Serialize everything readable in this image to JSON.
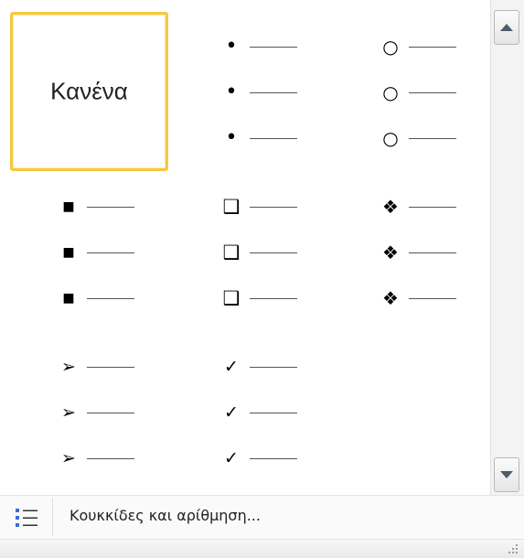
{
  "gallery": {
    "none_label": "Κανένα",
    "cells": [
      {
        "name": "bullet-dot",
        "glyph": "•",
        "style": "g-dot"
      },
      {
        "name": "bullet-hollow-circle",
        "glyph": "○",
        "style": "g-circle"
      },
      {
        "name": "bullet-filled-square",
        "glyph": "■",
        "style": "g-square"
      },
      {
        "name": "bullet-hollow-box",
        "glyph": "❑",
        "style": "g-box"
      },
      {
        "name": "bullet-four-diamond",
        "glyph": "❖",
        "style": "g-diamond"
      },
      {
        "name": "bullet-arrowhead",
        "glyph": "➢",
        "style": "g-arrow"
      },
      {
        "name": "bullet-checkmark",
        "glyph": "✓",
        "style": "g-check"
      }
    ]
  },
  "scrollbar": {
    "up_icon": "triangle-up-icon",
    "down_icon": "triangle-down-icon"
  },
  "menu": {
    "define_bullets_label": "Κουκκίδες και αρίθμηση...",
    "icon": "bulleted-list-icon"
  },
  "colors": {
    "selection_border": "#f5c842",
    "list_icon_blue": "#3b6bd6"
  }
}
